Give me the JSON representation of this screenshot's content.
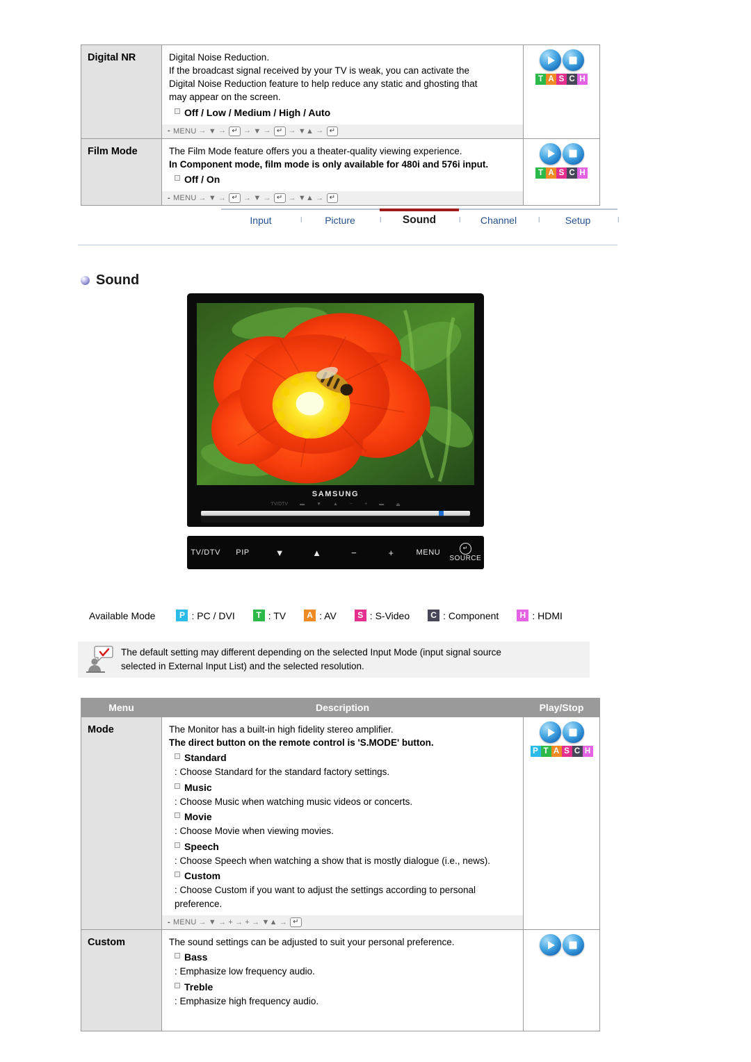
{
  "top_table": {
    "rows": [
      {
        "menu": "Digital NR",
        "lines": [
          {
            "text": "Digital Noise Reduction.",
            "bold": false
          },
          {
            "text": "If the broadcast signal received by your TV is weak, you can activate the",
            "bold": false
          },
          {
            "text": "Digital Noise Reduction feature to help reduce any static and ghosting that",
            "bold": false
          },
          {
            "text": "may appear on the screen.",
            "bold": false
          }
        ],
        "options": [
          "Off / Low / Medium / High / Auto"
        ],
        "path": [
          "MENU",
          "▼",
          "ENTER",
          "▼",
          "ENTER",
          "▼▲",
          "ENTER"
        ],
        "icons": {
          "orbs": [
            "play",
            "stop"
          ],
          "badge": [
            "T",
            "A",
            "S",
            "C",
            "H"
          ]
        }
      },
      {
        "menu": "Film Mode",
        "lines": [
          {
            "text": "The Film Mode feature offers you a theater-quality viewing experience.",
            "bold": false
          },
          {
            "text": "In Component mode, film mode is only available for 480i and 576i input.",
            "bold": true
          }
        ],
        "options": [
          "Off / On"
        ],
        "path": [
          "MENU",
          "▼",
          "ENTER",
          "▼",
          "ENTER",
          "▼▲",
          "ENTER"
        ],
        "icons": {
          "orbs": [
            "play",
            "stop"
          ],
          "badge": [
            "T",
            "A",
            "S",
            "C",
            "H"
          ]
        }
      }
    ]
  },
  "tabs": {
    "items": [
      {
        "label": "Input",
        "active": false
      },
      {
        "label": "Picture",
        "active": false
      },
      {
        "label": "Sound",
        "active": true
      },
      {
        "label": "Channel",
        "active": false
      },
      {
        "label": "Setup",
        "active": false
      }
    ],
    "separator": "l",
    "active_color": "#9e1b1b"
  },
  "section": {
    "title": "Sound"
  },
  "monitor": {
    "brand": "SAMSUNG",
    "screen_alt": "Photo of an orange-red poppy flower with a yellow center and a honeybee, green foliage background",
    "controls": [
      {
        "label": "TV/DTV",
        "type": "text"
      },
      {
        "label": "PIP",
        "type": "text"
      },
      {
        "label": "▼",
        "type": "glyph"
      },
      {
        "label": "▲",
        "type": "glyph"
      },
      {
        "label": "−",
        "type": "glyph"
      },
      {
        "label": "+",
        "type": "glyph"
      },
      {
        "label": "MENU",
        "type": "text"
      },
      {
        "label": "SOURCE",
        "type": "source"
      }
    ]
  },
  "available_mode": {
    "label": "Available Mode",
    "items": [
      {
        "key": "P",
        "text": ": PC / DVI",
        "color": "#2bbbe8"
      },
      {
        "key": "T",
        "text": ": TV",
        "color": "#2db84a"
      },
      {
        "key": "A",
        "text": ": AV",
        "color": "#f08a25"
      },
      {
        "key": "S",
        "text": ": S-Video",
        "color": "#e52f8e"
      },
      {
        "key": "C",
        "text": ": Component",
        "color": "#474759"
      },
      {
        "key": "H",
        "text": ": HDMI",
        "color": "#e463e4"
      }
    ]
  },
  "note": {
    "icon": "person-with-checkmark-bubble-icon",
    "line1": "The default setting may different depending on the selected Input Mode (input signal source",
    "line2": "selected in External Input List) and the selected resolution."
  },
  "bottom_table": {
    "headers": {
      "menu": "Menu",
      "description": "Description",
      "playstop": "Play/Stop"
    },
    "rows": [
      {
        "menu": "Mode",
        "lines": [
          {
            "text": "The Monitor has a built-in high fidelity stereo amplifier.",
            "bold": false
          },
          {
            "text": "The direct button on the remote control is 'S.MODE' button.",
            "bold": true
          }
        ],
        "items": [
          {
            "option": "Standard",
            "detail": ": Choose Standard for the standard factory settings."
          },
          {
            "option": "Music",
            "detail": ": Choose Music when watching music videos or concerts."
          },
          {
            "option": "Movie",
            "detail": ": Choose Movie when viewing movies."
          },
          {
            "option": "Speech",
            "detail": ": Choose Speech when watching a show that is mostly dialogue (i.e., news)."
          },
          {
            "option": "Custom",
            "detail": ": Choose Custom if you want to adjust the settings according to personal preference."
          }
        ],
        "path": [
          "MENU",
          "▼",
          "+",
          "+",
          "▼▲",
          "ENTER"
        ],
        "icons": {
          "orbs": [
            "play",
            "stop"
          ],
          "badge": [
            "P",
            "T",
            "A",
            "S",
            "C",
            "H"
          ]
        }
      },
      {
        "menu": "Custom",
        "lines": [
          {
            "text": "The sound settings can be adjusted to suit your personal preference.",
            "bold": false
          }
        ],
        "items": [
          {
            "option": "Bass",
            "detail": ": Emphasize low frequency audio."
          },
          {
            "option": "Treble",
            "detail": ": Emphasize high frequency audio."
          }
        ],
        "path": [],
        "icons": {
          "orbs": [
            "play",
            "stop"
          ],
          "badge": []
        }
      }
    ]
  }
}
